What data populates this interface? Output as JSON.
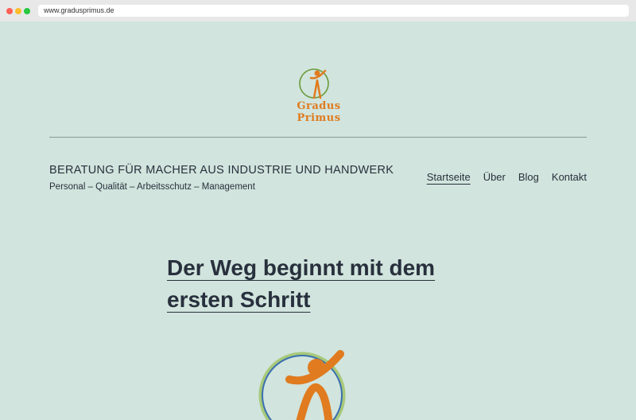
{
  "browser": {
    "url": "www.gradusprimus.de"
  },
  "header": {
    "logo_text": "Gradus Primus",
    "site_title": "BERATUNG FÜR MACHER AUS INDUSTRIE UND HANDWERK",
    "tagline": "Personal – Qualität – Arbeitsschutz – Management"
  },
  "nav": {
    "items": [
      {
        "label": "Startseite",
        "current": true
      },
      {
        "label": "Über"
      },
      {
        "label": "Blog"
      },
      {
        "label": "Kontakt"
      }
    ]
  },
  "main": {
    "headline": "Der Weg beginnt mit dem ersten Schritt"
  },
  "colors": {
    "background": "#d1e4dd",
    "text": "#28303d",
    "accent_orange": "#e07b1f",
    "logo_green": "#6a9a3a",
    "logo_blue": "#3a6fb0"
  },
  "icons": {
    "logo": "gradus-primus-figure-logo",
    "hero": "gradus-primus-figure-large"
  }
}
